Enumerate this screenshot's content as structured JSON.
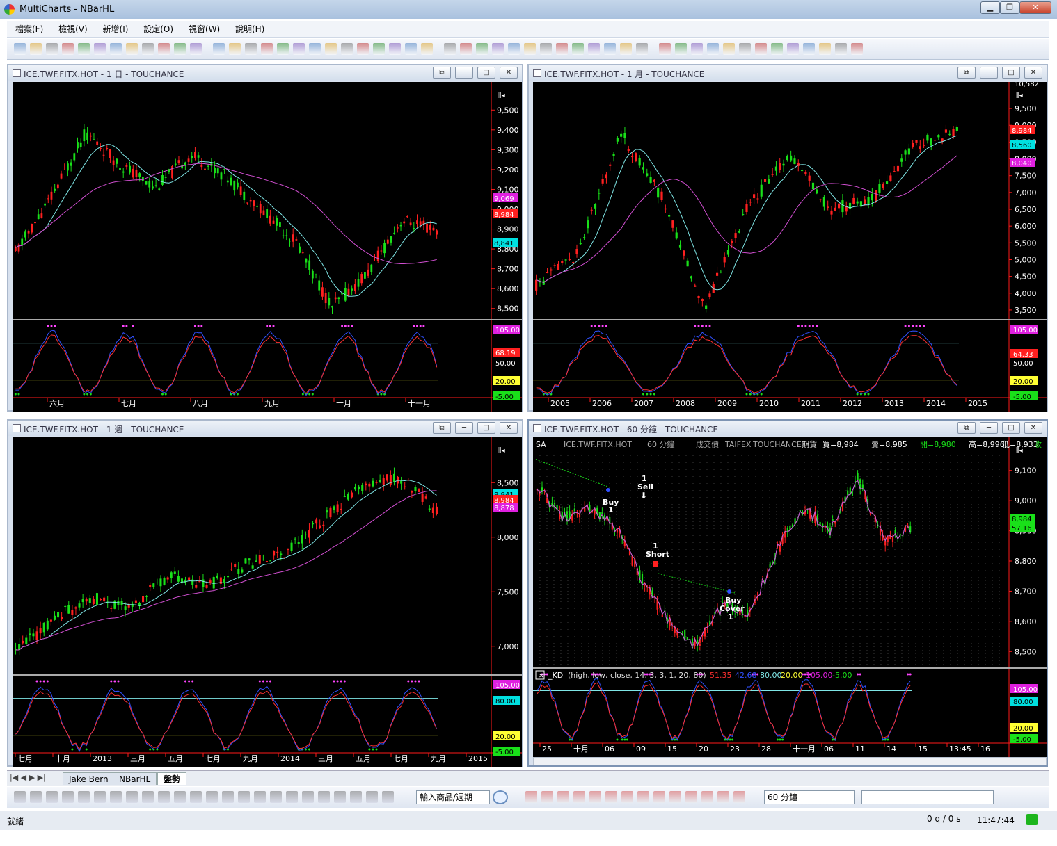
{
  "app": {
    "title": "MultiCharts - NBarHL"
  },
  "menu": [
    "檔案(F)",
    "檢視(V)",
    "新增(I)",
    "設定(O)",
    "視窗(W)",
    "說明(H)"
  ],
  "windows": {
    "daily": {
      "title": "ICE.TWF.FITX.HOT - 1 日 - TOUCHANCE",
      "price_ticks": [
        "9,500",
        "9,400",
        "9,300",
        "9,200",
        "9,100",
        "9,000",
        "8,900",
        "8,800",
        "8,700",
        "8,600",
        "8,500"
      ],
      "price_tags": [
        "9,069",
        "8,984",
        "8,841"
      ],
      "osc_tags": [
        "105.00",
        "68.19",
        "50.00",
        "20.00",
        "-5.00"
      ],
      "dates": [
        "六月",
        "七月",
        "八月",
        "九月",
        "十月",
        "十一月"
      ]
    },
    "monthly": {
      "title": "ICE.TWF.FITX.HOT - 1 月 - TOUCHANCE",
      "price_ticks": [
        "9,500",
        "9,000",
        "8,500",
        "8,000",
        "7,500",
        "7,000",
        "6,500",
        "6,000",
        "5,500",
        "5,000",
        "4,500",
        "4,000",
        "3,500"
      ],
      "top_label": "10,582",
      "price_tags": [
        "8,984",
        "8,560",
        "8,040"
      ],
      "osc_tags": [
        "105.00",
        "64.33",
        "50.00",
        "20.00",
        "-5.00"
      ],
      "dates": [
        "2005",
        "2006",
        "2007",
        "2008",
        "2009",
        "2010",
        "2011",
        "2012",
        "2013",
        "2014",
        "2015"
      ]
    },
    "weekly": {
      "title": "ICE.TWF.FITX.HOT - 1 週 - TOUCHANCE",
      "price_ticks": [
        "8,500",
        "8,000",
        "7,500",
        "7,000"
      ],
      "price_tags": [
        "8,941",
        "8,984",
        "8,878"
      ],
      "osc_tags": [
        "105.00",
        "80.00",
        "20.00",
        "-5.00"
      ],
      "dates": [
        "七月",
        "十月",
        "2013",
        "三月",
        "五月",
        "七月",
        "九月",
        "2014",
        "三月",
        "五月",
        "七月",
        "九月",
        "2015"
      ]
    },
    "hourly": {
      "title": "ICE.TWF.FITX.HOT - 60 分鐘 - TOUCHANCE",
      "info": {
        "sa": "SA",
        "symbol": "ICE.TWF.FITX.HOT",
        "interval": "60 分鐘",
        "field": "成交價",
        "exchange": "TAIFEX",
        "feed": "TOUCHANCE",
        "type": "期貨",
        "buy": "買=8,984",
        "sell": "賣=8,985",
        "open": "開=8,980",
        "high": "高=8,996",
        "low": "低=8,933",
        "close": "收"
      },
      "price_ticks": [
        "9,100",
        "9,000",
        "8,900",
        "8,800",
        "8,700",
        "8,600",
        "8,500"
      ],
      "price_tags": [
        "8,984",
        "57.16"
      ],
      "kd_label": {
        "name": "_KD",
        "params": "(high, low, close, 14, 3, 3, 1, 20, 80)",
        "v1": "51.35",
        "v2": "42.68",
        "v3": "80.00",
        "v4": "20.00",
        "v5": "105.00",
        "v6": "-5.00"
      },
      "osc_tags": [
        "105.00",
        "80.00",
        "20.00",
        "-5.00"
      ],
      "trade_labels": {
        "buy": "Buy",
        "sell": "Sell",
        "short": "Short",
        "cover1": "Buy",
        "cover2": "Cover",
        "one": "1"
      },
      "dates": [
        "25",
        "十月",
        "06",
        "09",
        "15",
        "20",
        "23",
        "28",
        "十一月",
        "06",
        "11",
        "14",
        "15",
        "13:45",
        "16"
      ]
    }
  },
  "tabs": [
    "Jake Bern",
    "NBarHL",
    "盤勢"
  ],
  "drawbar": {
    "symbol_placeholder": "輸入商品/週期",
    "interval": "60 分鐘"
  },
  "status": {
    "ready": "就緒",
    "queue": "0 q / 0 s",
    "time": "11:47:44"
  },
  "colors": {
    "up": "#ff2020",
    "down": "#19e019",
    "ma_fast": "#7fe6e6",
    "ma_slow": "#d24fd2",
    "k": "#3050ff",
    "d": "#ff3030",
    "axis": "#ff1a1a"
  }
}
